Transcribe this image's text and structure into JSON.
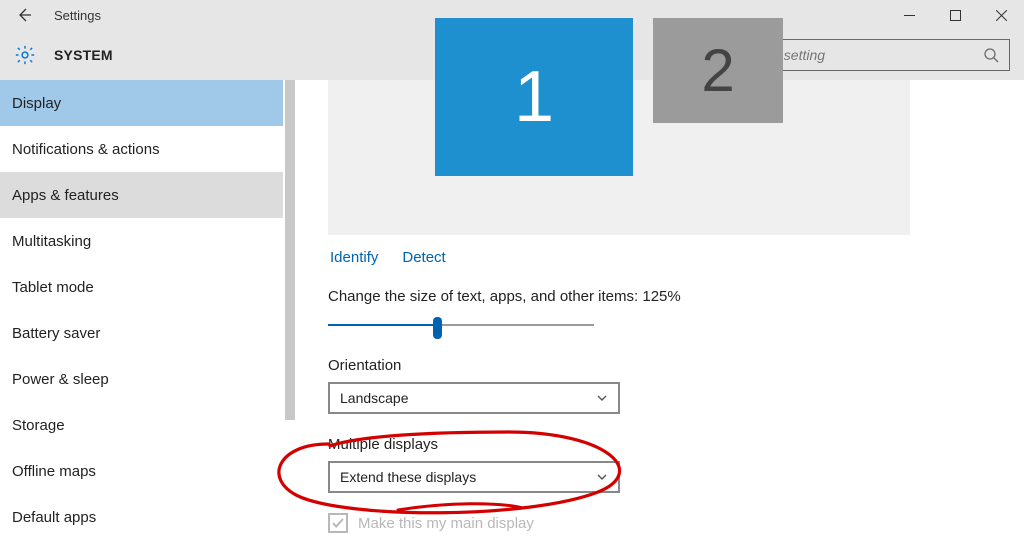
{
  "window": {
    "title": "Settings"
  },
  "header": {
    "section": "SYSTEM",
    "search_placeholder": "Find a setting"
  },
  "sidebar": {
    "items": [
      {
        "label": "Display",
        "state": "selected"
      },
      {
        "label": "Notifications & actions",
        "state": ""
      },
      {
        "label": "Apps & features",
        "state": "hover"
      },
      {
        "label": "Multitasking",
        "state": ""
      },
      {
        "label": "Tablet mode",
        "state": ""
      },
      {
        "label": "Battery saver",
        "state": ""
      },
      {
        "label": "Power & sleep",
        "state": ""
      },
      {
        "label": "Storage",
        "state": ""
      },
      {
        "label": "Offline maps",
        "state": ""
      },
      {
        "label": "Default apps",
        "state": ""
      }
    ]
  },
  "displays": {
    "monitor1": "1",
    "monitor2": "2",
    "identify": "Identify",
    "detect": "Detect"
  },
  "scaling": {
    "label": "Change the size of text, apps, and other items: 125%"
  },
  "orientation": {
    "label": "Orientation",
    "value": "Landscape"
  },
  "multiple": {
    "label": "Multiple displays",
    "value": "Extend these displays"
  },
  "maindisp": {
    "label": "Make this my main display"
  },
  "annotation": {
    "stroke": "#d40000"
  }
}
